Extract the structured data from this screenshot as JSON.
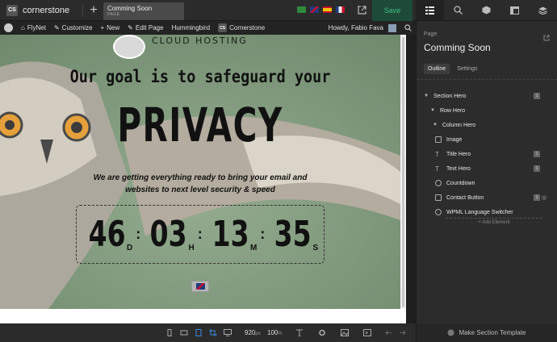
{
  "app": {
    "brand": "cornerstone",
    "add_label": "+",
    "tab": {
      "title": "Comming Soon",
      "subtitle": "PAGE"
    },
    "save_label": "Save",
    "flags": [
      "brazil-flag-icon",
      "uk-flag-icon",
      "spain-flag-icon",
      "france-flag-icon"
    ]
  },
  "iconbar": [
    "layout-icon",
    "search-icon",
    "box-icon",
    "template-icon",
    "layers-icon"
  ],
  "wpbar": {
    "site": "FlyNet",
    "customize": "Customize",
    "new": "New",
    "edit": "Edit Page",
    "hummingbird": "Hummingbird",
    "cornerstone": "Cornerstone",
    "howdy": "Howdy, Fabio Fava"
  },
  "preview": {
    "logo_text": "CLOUD HOSTING",
    "goal": "Our goal is to safeguard your",
    "privacy": "PRIVACY",
    "sub1": "We are getting everything ready to bring your email and",
    "sub2": "websites to next level security & speed",
    "countdown": [
      {
        "value": "46",
        "unit": "D"
      },
      {
        "value": "03",
        "unit": "H"
      },
      {
        "value": "13",
        "unit": "M"
      },
      {
        "value": "35",
        "unit": "S"
      }
    ],
    "separator": ":"
  },
  "panel": {
    "label": "Page",
    "title": "Comming Soon",
    "tabs": [
      "Outline",
      "Settings"
    ],
    "tree": [
      {
        "label": "Section Hero",
        "level": 0,
        "caret": true,
        "badge": "1"
      },
      {
        "label": "Row Hero",
        "level": 1,
        "caret": true
      },
      {
        "label": "Column Hero",
        "level": 2,
        "caret": true
      },
      {
        "label": "Image",
        "level": 3,
        "icon": "image-icon"
      },
      {
        "label": "Title Hero",
        "level": 3,
        "icon": "text-icon",
        "badge": "1"
      },
      {
        "label": "Text Hero",
        "level": 3,
        "icon": "text-icon",
        "badge": "1"
      },
      {
        "label": "Countdown",
        "level": 3,
        "icon": "timer-icon"
      },
      {
        "label": "Contact Button",
        "level": 3,
        "icon": "button-icon",
        "badge": "1",
        "eye": true
      },
      {
        "label": "WPML Language Switcher",
        "level": 3,
        "icon": "gear-icon"
      }
    ],
    "add_element": "+ Add Element"
  },
  "bottombar": {
    "width_value": "920",
    "width_unit": "px",
    "zoom": "100",
    "zoom_unit": "%",
    "make_template": "Make Section Template"
  }
}
